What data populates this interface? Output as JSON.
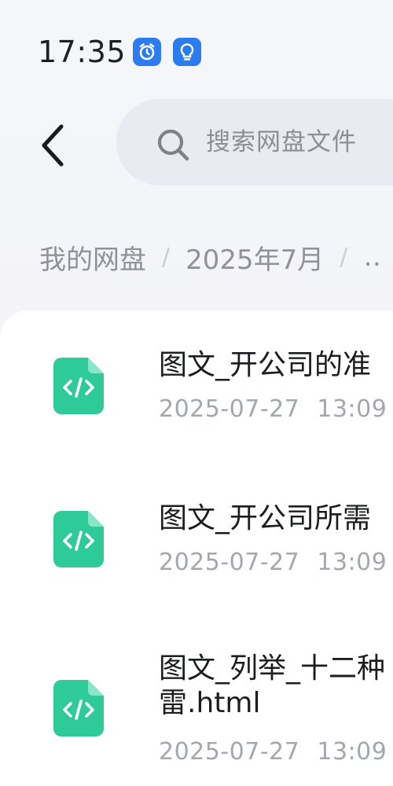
{
  "status_bar": {
    "time": "17:35",
    "icons": [
      "alarm-icon",
      "lightbulb-icon"
    ]
  },
  "header": {
    "back_icon": "chevron-left-icon",
    "search": {
      "icon": "search-icon",
      "placeholder": "搜索网盘文件"
    }
  },
  "breadcrumb": {
    "items": [
      "我的网盘",
      "2025年7月",
      "…"
    ],
    "separator": "/"
  },
  "files": [
    {
      "name": "图文_开公司的准",
      "date": "2025-07-27",
      "time": "13:09",
      "icon": "html-file-icon"
    },
    {
      "name": "图文_开公司所需",
      "date": "2025-07-27",
      "time": "13:09",
      "icon": "html-file-icon"
    },
    {
      "name": "图文_列举_十二种",
      "name_line2": "雷.html",
      "date": "2025-07-27",
      "time": "13:09",
      "icon": "html-file-icon"
    }
  ],
  "colors": {
    "accent_blue": "#2b7cf0",
    "file_icon_green": "#2ecb98",
    "text_primary": "#1c1d20",
    "text_secondary": "#a3a7ae"
  }
}
